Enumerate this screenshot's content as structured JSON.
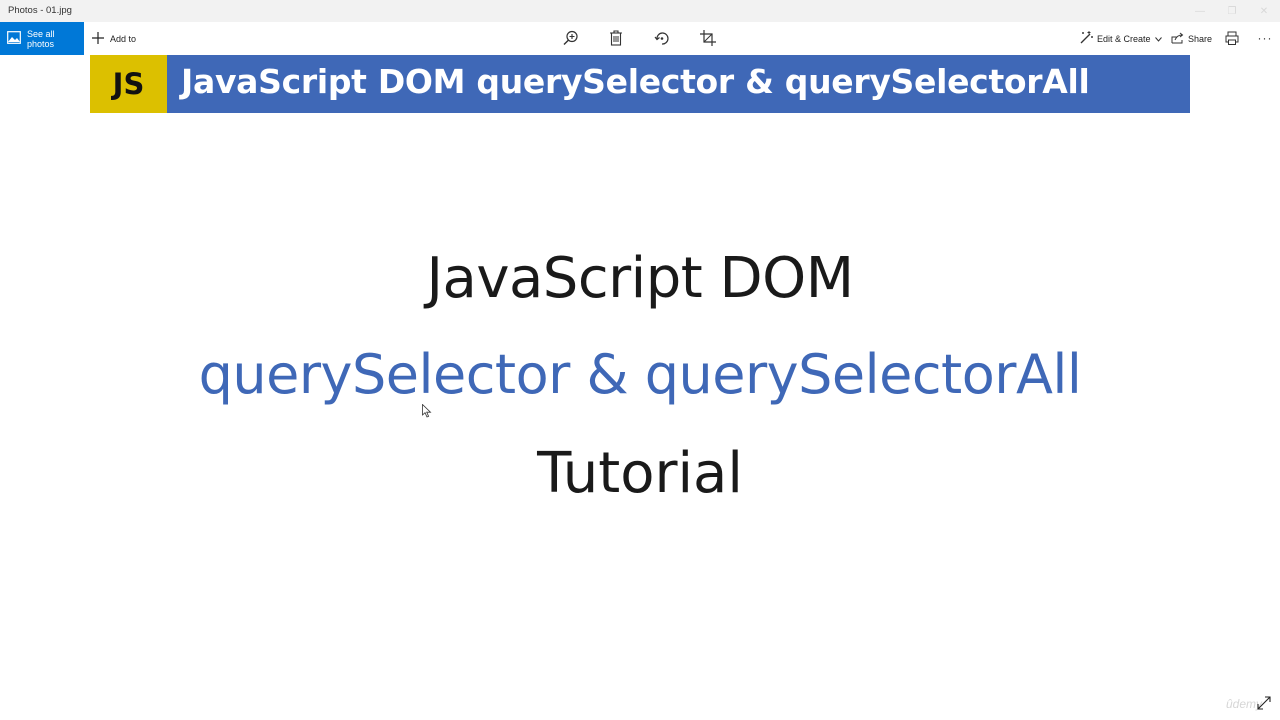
{
  "window": {
    "title": "Photos - 01.jpg"
  },
  "toolbar": {
    "see_all_photos": "See all photos",
    "add_to": "Add to",
    "edit_create": "Edit & Create",
    "share": "Share",
    "icons": [
      "zoom-in-icon",
      "delete-icon",
      "rotate-icon",
      "crop-icon",
      "print-icon",
      "more-icon"
    ]
  },
  "image": {
    "logo": "JS",
    "banner": "JavaScript DOM querySelector & querySelectorAll",
    "line1": "JavaScript DOM",
    "line2": "querySelector & querySelectorAll",
    "line3": "Tutorial",
    "watermark": "ûdemy",
    "colors": {
      "banner_bg": "#3f68b7",
      "logo_bg": "#dcc000",
      "accent_text": "#3f68b7",
      "toolbar_accent": "#0078d7"
    }
  }
}
